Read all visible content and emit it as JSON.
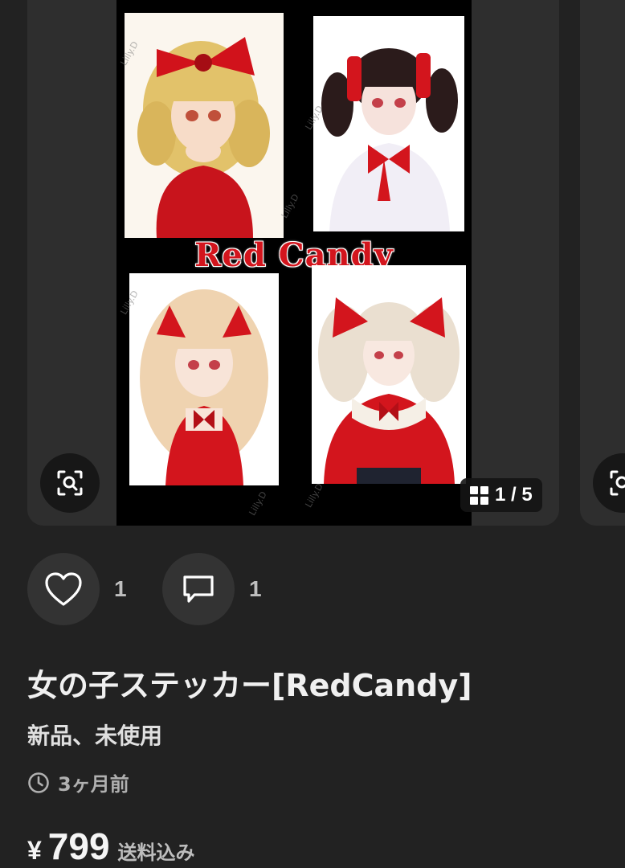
{
  "gallery": {
    "image_title": "Red Candy",
    "watermark": "Lilly.D",
    "counter": "1 / 5",
    "icons": {
      "zoom": "zoom-scan-icon",
      "grid": "grid-icon"
    }
  },
  "actions": {
    "like": {
      "icon": "heart-icon",
      "count": "1"
    },
    "comment": {
      "icon": "comment-icon",
      "count": "1"
    }
  },
  "item": {
    "title": "女の子ステッカー[RedCandy]",
    "condition": "新品、未使用",
    "posted": "3ヶ月前",
    "price_currency": "¥",
    "price": "799",
    "price_note": "送料込み"
  },
  "colors": {
    "background": "#222222",
    "card": "#2e2e2e",
    "accent_red": "#d3151d"
  }
}
